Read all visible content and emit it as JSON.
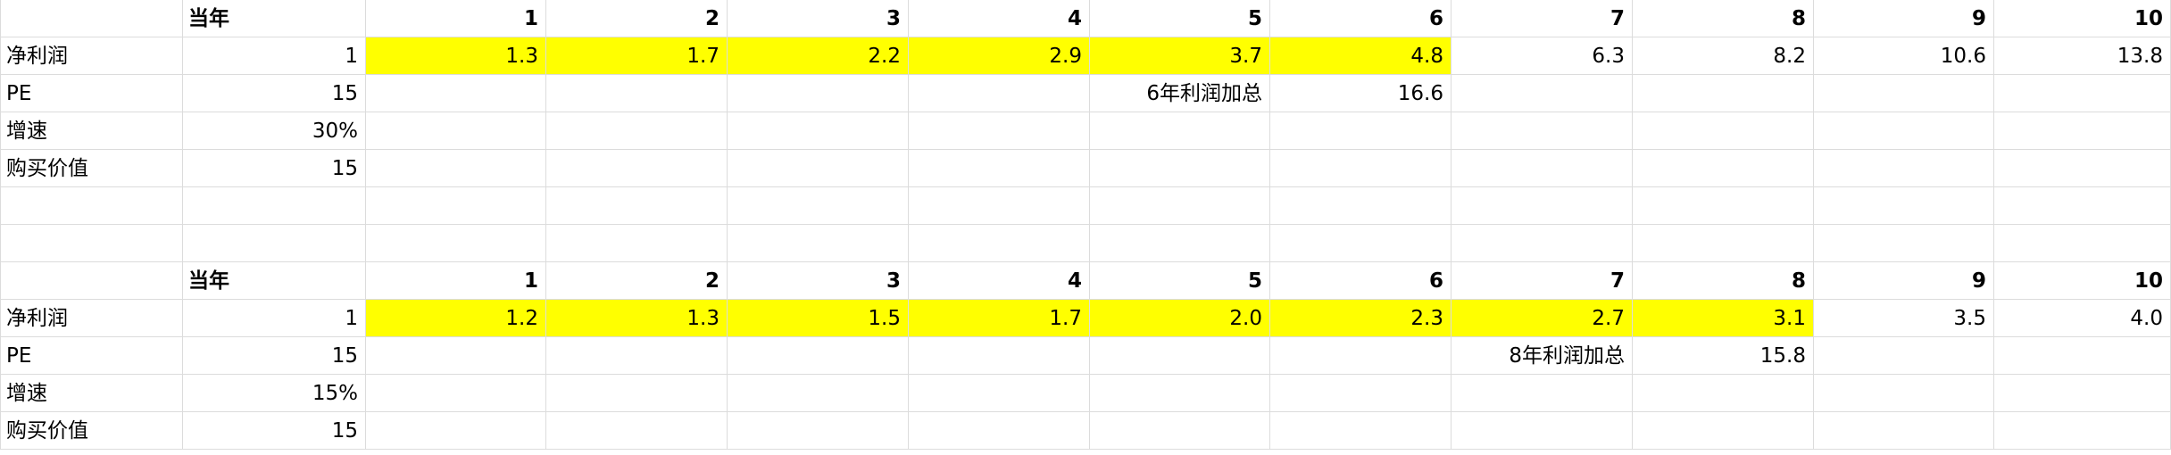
{
  "highlight_color": "#ffff00",
  "grid_color": "#dcdcdc",
  "blocks": [
    {
      "header": [
        "",
        "当年",
        "1",
        "2",
        "3",
        "4",
        "5",
        "6",
        "7",
        "8",
        "9",
        "10"
      ],
      "rows": [
        {
          "label": "净利润",
          "values": [
            "1",
            "1.3",
            "1.7",
            "2.2",
            "2.9",
            "3.7",
            "4.8",
            "6.3",
            "8.2",
            "10.6",
            "13.8"
          ],
          "highlight_from": 1,
          "highlight_to": 6
        },
        {
          "label": "PE",
          "values": [
            "15",
            "",
            "",
            "",
            "",
            "6年利润加总",
            "16.6",
            "",
            "",
            "",
            ""
          ]
        },
        {
          "label": "增速",
          "values": [
            "30%",
            "",
            "",
            "",
            "",
            "",
            "",
            "",
            "",
            "",
            ""
          ]
        },
        {
          "label": "购买价值",
          "values": [
            "15",
            "",
            "",
            "",
            "",
            "",
            "",
            "",
            "",
            "",
            ""
          ]
        }
      ]
    },
    {
      "header": [
        "",
        "当年",
        "1",
        "2",
        "3",
        "4",
        "5",
        "6",
        "7",
        "8",
        "9",
        "10"
      ],
      "rows": [
        {
          "label": "净利润",
          "values": [
            "1",
            "1.2",
            "1.3",
            "1.5",
            "1.7",
            "2.0",
            "2.3",
            "2.7",
            "3.1",
            "3.5",
            "4.0"
          ],
          "highlight_from": 1,
          "highlight_to": 8
        },
        {
          "label": "PE",
          "values": [
            "15",
            "",
            "",
            "",
            "",
            "",
            "",
            "8年利润加总",
            "15.8",
            "",
            ""
          ]
        },
        {
          "label": "增速",
          "values": [
            "15%",
            "",
            "",
            "",
            "",
            "",
            "",
            "",
            "",
            "",
            ""
          ]
        },
        {
          "label": "购买价值",
          "values": [
            "15",
            "",
            "",
            "",
            "",
            "",
            "",
            "",
            "",
            "",
            ""
          ]
        }
      ]
    }
  ]
}
